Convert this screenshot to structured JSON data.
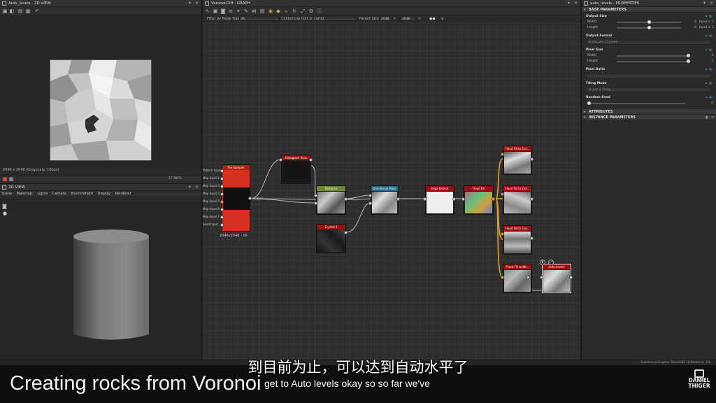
{
  "view2d": {
    "title": "Auto_levels - 2D VIEW",
    "status": "2048 x 2048 (Grayscale, 16bpc)",
    "zoom": "17.68%"
  },
  "view3d": {
    "title": "3D VIEW",
    "menu": [
      "Scene",
      "Materials",
      "Lights",
      "Camera",
      "Environment",
      "Display",
      "Renderer"
    ]
  },
  "graph": {
    "title": "VoronoiCliff - GRAPH",
    "filter_label": "Filter by Node Type",
    "filter_value": "All",
    "contains_label": "Containing text or variable",
    "parent_size_label": "Parent Size:",
    "parent_size_w": "2048",
    "parent_size_h": "2048",
    "tile_sampler": {
      "title": "Tile Sampler",
      "size_label": "2048x2048 - 16",
      "inputs": [
        "Pattern Input 1",
        "Map Input 2",
        "Map Input 3",
        "Map Input 4",
        "Map Input 5",
        "Map Input 6",
        "Map Input 7",
        "Seed Input"
      ],
      "output": "Output"
    },
    "nodes": [
      {
        "title": "Histogram Scan",
        "color": "#9a1010"
      },
      {
        "title": "Distance",
        "color": "#6b8a30"
      },
      {
        "title": "Crystal 1",
        "color": "#9a1010"
      },
      {
        "title": "Directional Warp",
        "color": "#1f6a8a"
      },
      {
        "title": "Edge Detect",
        "color": "#9a1010"
      },
      {
        "title": "Flood Fill",
        "color": "#9a1010"
      },
      {
        "title": "Flood Fill to Gra...",
        "color": "#9a1010"
      },
      {
        "title": "Flood Fill to Gra...",
        "color": "#9a1010"
      },
      {
        "title": "Flood Fill to Gra...",
        "color": "#9a1010"
      },
      {
        "title": "Flood Fill to Bb...",
        "color": "#9a1010"
      },
      {
        "title": "Auto Levels",
        "color": "#9a1010"
      }
    ]
  },
  "properties": {
    "title": "auto_levels - PROPERTIES",
    "base_section": "BASE PARAMETERS",
    "output_size": "Output Size",
    "width": "Width",
    "height": "Height",
    "output_size_width_value": "0",
    "output_size_height_value": "0",
    "output_size_width_extra": "Input x 1",
    "output_size_height_extra": "Input x 1",
    "output_format": "Output Format",
    "output_format_value": "8 bits per Channel",
    "pixel_size": "Pixel Size",
    "pixel_size_width_value": "1",
    "pixel_size_height_value": "1",
    "pixel_ratio": "Pixel Ratio",
    "tiling_mode": "Tiling Mode",
    "tiling_mode_value": "H and V Tiling",
    "random_seed": "Random Seed",
    "random_seed_value": "0",
    "attributes_section": "ATTRIBUTES",
    "instance_section": "INSTANCE PARAMETERS"
  },
  "statusbar": {
    "text": "Substance Engine: Direct3D 10   Memory: 1%"
  },
  "overlay": {
    "title": "Creating rocks from Voronoi",
    "subtitle_zh": "到目前为止，可以达到自动水平了",
    "subtitle_en": "get to Auto levels okay so so far we've",
    "logo_line1": "DANIEL",
    "logo_line2": "THIGER"
  }
}
